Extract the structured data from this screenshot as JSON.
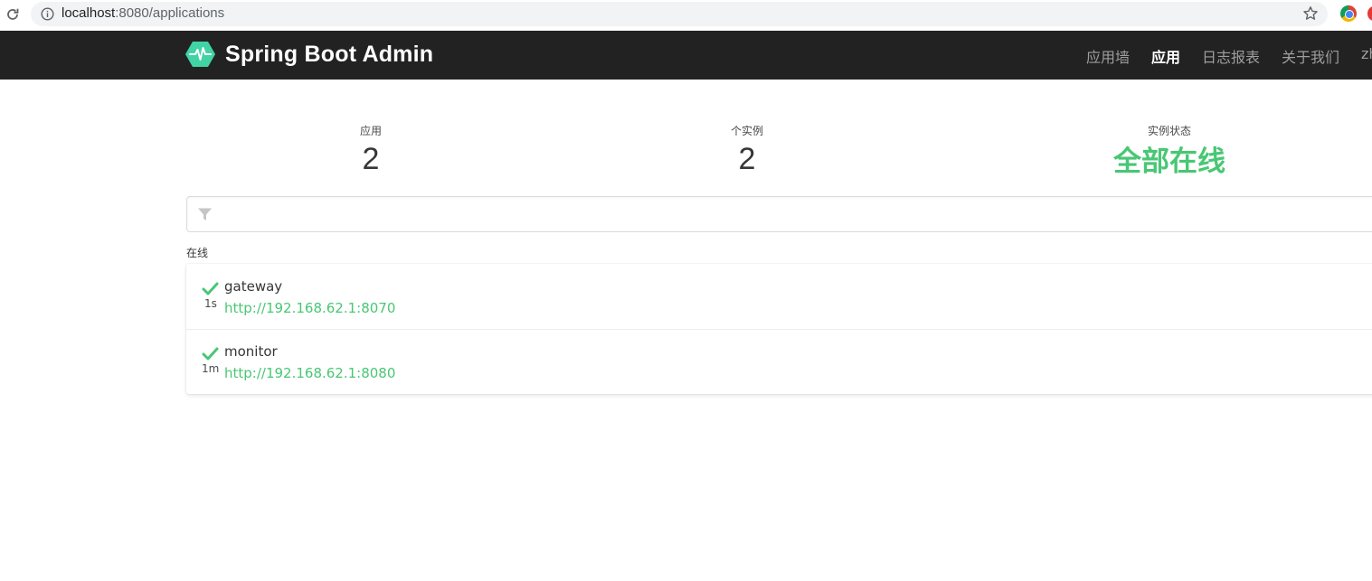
{
  "browser": {
    "url_host": "localhost",
    "url_path": ":8080/applications"
  },
  "navbar": {
    "brand": "Spring Boot Admin",
    "items": [
      {
        "label": "应用墙"
      },
      {
        "label": "应用",
        "active": true
      },
      {
        "label": "日志报表"
      },
      {
        "label": "关于我们"
      },
      {
        "label": "zh"
      }
    ]
  },
  "summary": {
    "applications_label": "应用",
    "applications_count": "2",
    "instances_label": "个实例",
    "instances_count": "2",
    "status_label": "实例状态",
    "status_value": "全部在线"
  },
  "filter": {
    "placeholder": "",
    "value": ""
  },
  "group": {
    "label": "在线",
    "apps": [
      {
        "name": "gateway",
        "since": "1s",
        "url": "http://192.168.62.1:8070",
        "status": "UP"
      },
      {
        "name": "monitor",
        "since": "1m",
        "url": "http://192.168.62.1:8080",
        "status": "UP"
      }
    ]
  },
  "colors": {
    "accent": "#48c774",
    "navbar": "#222222"
  }
}
